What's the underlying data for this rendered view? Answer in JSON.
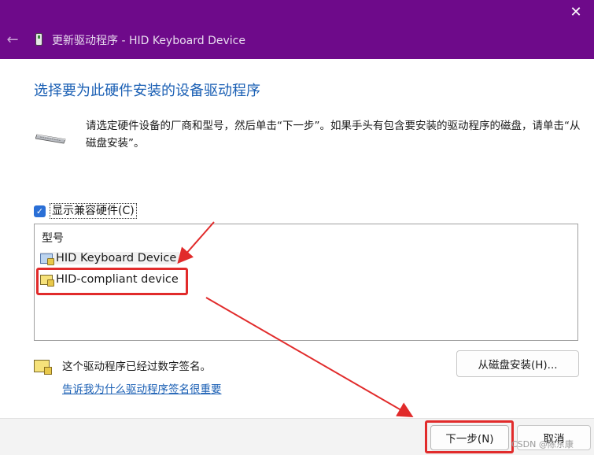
{
  "window": {
    "title": "更新驱动程序 - HID Keyboard Device",
    "back_icon": "←",
    "close_icon": "✕"
  },
  "heading": "选择要为此硬件安装的设备驱动程序",
  "intro": {
    "text": "请选定硬件设备的厂商和型号，然后单击“下一步”。如果手头有包含要安装的驱动程序的磁盘，请单击“从磁盘安装”。"
  },
  "compat": {
    "label": "显示兼容硬件(C)",
    "checked": true,
    "check_glyph": "✓"
  },
  "model_list": {
    "header": "型号",
    "items": [
      {
        "label": "HID Keyboard Device",
        "icon": "driver-icon"
      },
      {
        "label": "HID-compliant device",
        "icon": "driver-icon"
      }
    ]
  },
  "signed": {
    "text": "这个驱动程序已经过数字签名。",
    "link": "告诉我为什么驱动程序签名很重要"
  },
  "buttons": {
    "have_disk": "从磁盘安装(H)...",
    "next": "下一步(N)",
    "cancel": "取消"
  },
  "watermark": "CSDN @陈东康",
  "colors": {
    "titlebar": "#6e0a8a",
    "heading": "#1a5fb4",
    "annotation": "#e12b2b"
  }
}
